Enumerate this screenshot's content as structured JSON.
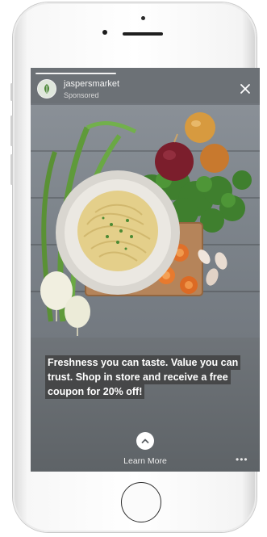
{
  "story": {
    "account_name": "jaspersmarket",
    "sponsored_label": "Sponsored",
    "caption": "Freshness you can taste. Value you can trust. Shop in store and receive a free coupon for 20% off!",
    "cta_label": "Learn More",
    "more_label": "•••"
  },
  "colors": {
    "screen_bg": "#6a6f74",
    "caption_highlight": "#3c3c3c",
    "text": "#ffffff"
  },
  "icons": {
    "close": "close-icon",
    "cta": "chevron-up-icon",
    "avatar": "leaf-icon"
  }
}
